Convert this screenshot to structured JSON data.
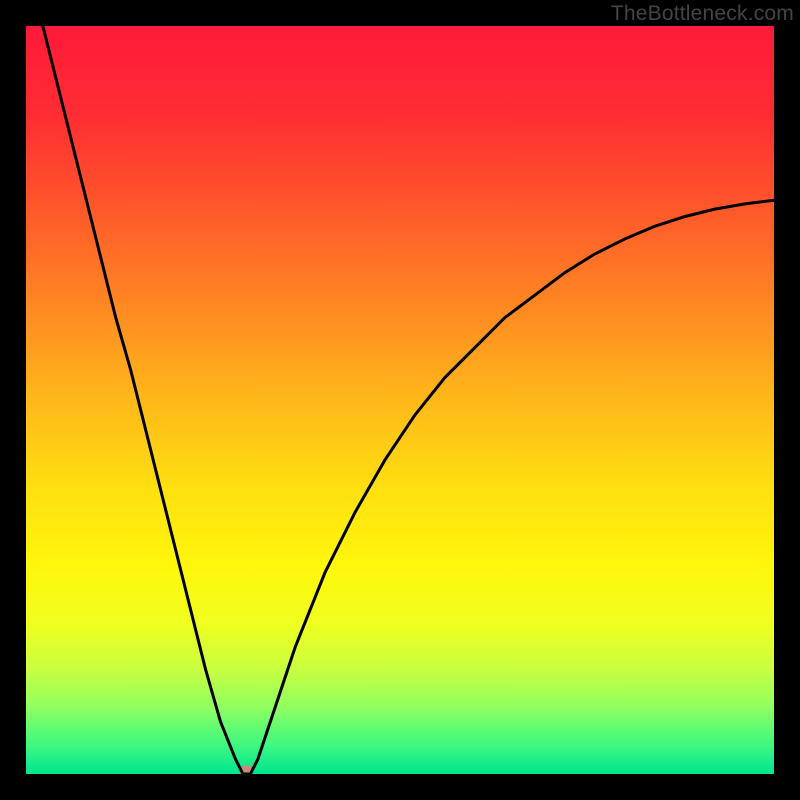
{
  "attribution": "TheBottleneck.com",
  "chart_data": {
    "type": "line",
    "title": "",
    "xlabel": "",
    "ylabel": "",
    "xlim": [
      0,
      100
    ],
    "ylim": [
      0,
      100
    ],
    "grid": false,
    "legend": false,
    "background_gradient": {
      "stops": [
        {
          "offset": 0.0,
          "color": "#ff1a3a"
        },
        {
          "offset": 0.12,
          "color": "#ff2d33"
        },
        {
          "offset": 0.25,
          "color": "#ff5a2a"
        },
        {
          "offset": 0.38,
          "color": "#ff8a22"
        },
        {
          "offset": 0.5,
          "color": "#ffb81a"
        },
        {
          "offset": 0.62,
          "color": "#ffe010"
        },
        {
          "offset": 0.72,
          "color": "#fff60a"
        },
        {
          "offset": 0.8,
          "color": "#f0ff20"
        },
        {
          "offset": 0.86,
          "color": "#c8ff40"
        },
        {
          "offset": 0.91,
          "color": "#90ff60"
        },
        {
          "offset": 0.96,
          "color": "#40f880"
        },
        {
          "offset": 1.0,
          "color": "#00e58f"
        }
      ]
    },
    "series": [
      {
        "name": "bottleneck-curve",
        "color": "#000000",
        "width": 3,
        "x": [
          0,
          2,
          4,
          6,
          8,
          10,
          12,
          14,
          16,
          18,
          20,
          22,
          24,
          26,
          28,
          29,
          30,
          31,
          32,
          34,
          36,
          38,
          40,
          44,
          48,
          52,
          56,
          60,
          64,
          68,
          72,
          76,
          80,
          84,
          88,
          92,
          96,
          100
        ],
        "values": [
          110,
          101,
          93,
          85,
          77,
          69,
          61,
          54,
          46,
          38,
          30,
          22,
          14,
          7,
          2,
          0,
          0,
          2,
          5,
          11,
          17,
          22,
          27,
          35,
          42,
          48,
          53,
          57,
          61,
          64,
          67,
          69.5,
          71.5,
          73.2,
          74.5,
          75.5,
          76.2,
          76.7
        ]
      }
    ],
    "marker": {
      "x": 29.5,
      "y": 0.5,
      "color": "#c98b7a",
      "rx": 7,
      "ry": 5
    }
  }
}
